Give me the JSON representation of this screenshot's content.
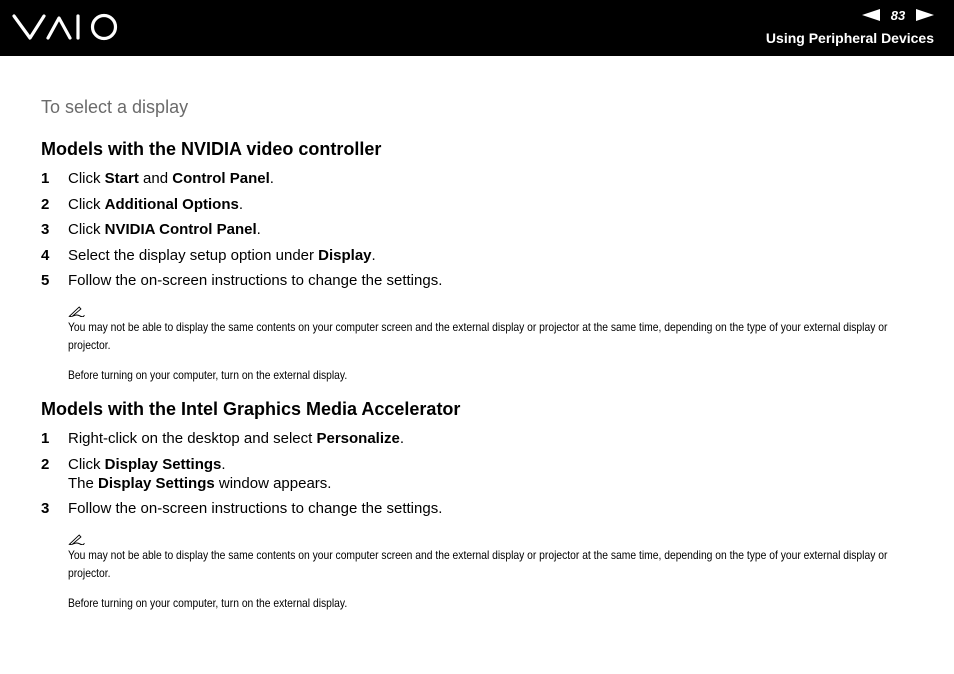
{
  "header": {
    "brand": "VAIO",
    "page_number": "83",
    "section": "Using Peripheral Devices"
  },
  "procedure_title": "To select a display",
  "nvidia": {
    "heading": "Models with the NVIDIA video controller",
    "steps": [
      {
        "n": "1",
        "parts": [
          {
            "t": "Click "
          },
          {
            "b": "Start"
          },
          {
            "t": " and "
          },
          {
            "b": "Control Panel"
          },
          {
            "t": "."
          }
        ]
      },
      {
        "n": "2",
        "parts": [
          {
            "t": "Click "
          },
          {
            "b": "Additional Options"
          },
          {
            "t": "."
          }
        ]
      },
      {
        "n": "3",
        "parts": [
          {
            "t": "Click "
          },
          {
            "b": "NVIDIA Control Panel"
          },
          {
            "t": "."
          }
        ]
      },
      {
        "n": "4",
        "parts": [
          {
            "t": "Select the display setup option under "
          },
          {
            "b": "Display"
          },
          {
            "t": "."
          }
        ]
      },
      {
        "n": "5",
        "parts": [
          {
            "t": "Follow the on-screen instructions to change the settings."
          }
        ]
      }
    ],
    "note_lines": [
      "You may not be able to display the same contents on your computer screen and the external display or projector at the same time, depending on the type of your external display or projector.",
      "Before turning on your computer, turn on the external display."
    ]
  },
  "intel": {
    "heading": "Models with the Intel Graphics Media Accelerator",
    "steps": [
      {
        "n": "1",
        "parts": [
          {
            "t": "Right-click on the desktop and select "
          },
          {
            "b": "Personalize"
          },
          {
            "t": "."
          }
        ]
      },
      {
        "n": "2",
        "parts": [
          {
            "t": "Click "
          },
          {
            "b": "Display Settings"
          },
          {
            "t": "."
          },
          {
            "br": true
          },
          {
            "t": "The "
          },
          {
            "b": "Display Settings"
          },
          {
            "t": " window appears."
          }
        ]
      },
      {
        "n": "3",
        "parts": [
          {
            "t": "Follow the on-screen instructions to change the settings."
          }
        ]
      }
    ],
    "note_lines": [
      "You may not be able to display the same contents on your computer screen and the external display or projector at the same time, depending on the type of your external display or projector.",
      "Before turning on your computer, turn on the external display."
    ]
  },
  "icons": {
    "prev": "previous-page-arrow-icon",
    "next": "next-page-arrow-icon",
    "note": "pencil-note-icon"
  },
  "colors": {
    "header_bg": "#000000",
    "header_text": "#ffffff",
    "procedure_title": "#6b6b6b"
  }
}
